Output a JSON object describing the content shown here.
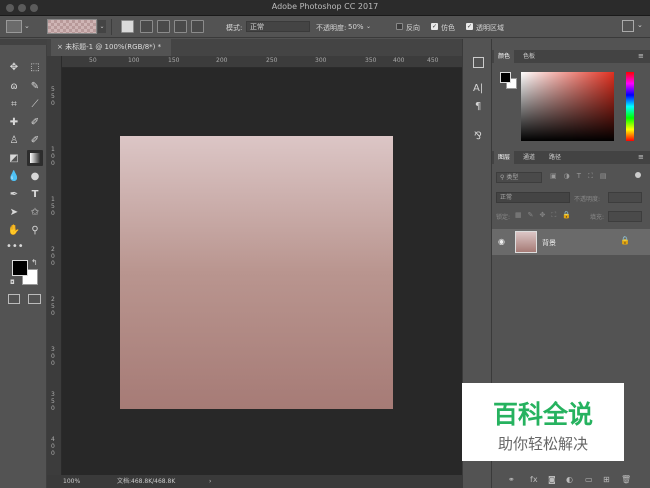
{
  "title": "Adobe Photoshop CC 2017",
  "options": {
    "mode_label": "模式:",
    "mode_value": "正常",
    "opacity_label": "不透明度:",
    "opacity_value": "50%",
    "reverse_label": "反向",
    "dither_label": "仿色",
    "transparency_label": "透明区域"
  },
  "document": {
    "tab_label": "未标题-1 @ 100%(RGB/8*)",
    "zoom": "100%",
    "doc_info": "文档:468.8K/468.8K"
  },
  "rulers": {
    "h": [
      "50",
      "100",
      "150",
      "200",
      "250",
      "300",
      "350",
      "400",
      "450"
    ],
    "v": [
      "5",
      "5",
      "0",
      "1",
      "0",
      "0",
      "1",
      "5",
      "0",
      "2",
      "0",
      "0",
      "2",
      "5",
      "0",
      "3",
      "0",
      "0",
      "3",
      "5",
      "0",
      "4",
      "0",
      "0"
    ]
  },
  "color_panel": {
    "tabs": [
      "颜色",
      "色板"
    ]
  },
  "layers_panel": {
    "tabs": [
      "图层",
      "通道",
      "路径"
    ],
    "kind_filter": "类型",
    "blend_mode": "正常",
    "opacity_label": "不透明度:",
    "lock_label": "锁定:",
    "fill_label": "填充:",
    "layer_name": "背景"
  },
  "watermark": {
    "line1": "百科全说",
    "line2": "助你轻松解决"
  },
  "colors": {
    "accent_green": "#26b25f",
    "gradient_top": "#dcc6c6",
    "gradient_bottom": "#a67b76"
  }
}
